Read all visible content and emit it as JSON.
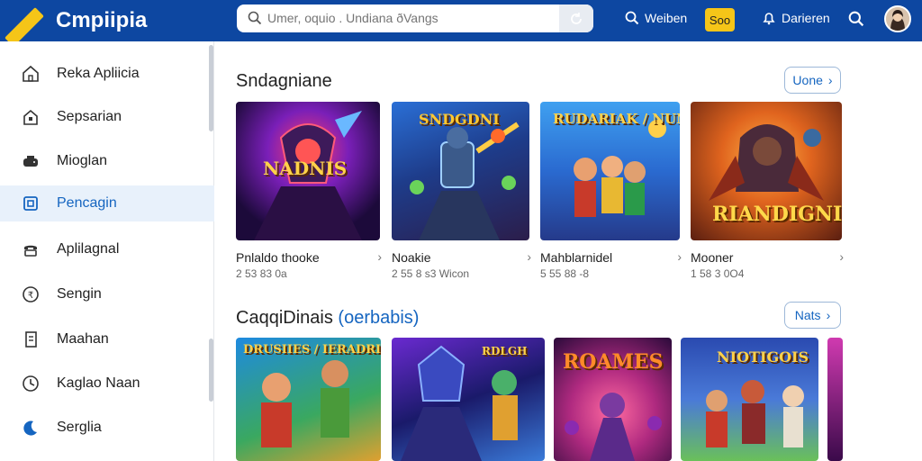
{
  "app": {
    "name": "Cmpiipia"
  },
  "search": {
    "placeholder": "Umer, oquio . Undiana ðVangs"
  },
  "topbar": {
    "item1": "Weiben",
    "badge": "Soo",
    "item2": "Darieren"
  },
  "sidebar": {
    "items": [
      {
        "label": "Reka Apliicia",
        "icon": "home-icon"
      },
      {
        "label": "Sepsarian",
        "icon": "house-lock-icon"
      },
      {
        "label": "Mioglan",
        "icon": "controller-icon"
      },
      {
        "label": "Pencagin",
        "icon": "square-icon",
        "active": true
      },
      {
        "label": "Aplilagnal",
        "icon": "phone-icon"
      },
      {
        "label": "Sengin",
        "icon": "coin-icon"
      },
      {
        "label": "Maahan",
        "icon": "document-icon"
      },
      {
        "label": "Kaglao Naan",
        "icon": "clock-icon"
      },
      {
        "label": "Serglia",
        "icon": "moon-icon"
      }
    ]
  },
  "section1": {
    "title": "Sndagniane",
    "more_label": "Uone",
    "cards": [
      {
        "title": "Pnlaldo thooke",
        "meta": "2 53 83 0a",
        "art": "NADNIS"
      },
      {
        "title": "Noakie",
        "meta": "2 55 8 s3 Wicon",
        "art": "SNDGDNI"
      },
      {
        "title": "Mahblarnidel",
        "meta": "5 55 88 -8",
        "art": "RUDARIAK / NUNME"
      },
      {
        "title": "Mooner",
        "meta": "1 58 3 0O4",
        "art": "RIANDIGNI"
      }
    ]
  },
  "section2": {
    "title": "CaqqiDinais",
    "title_accent": "(oerbabis)",
    "more_label": "Nats",
    "tiles": [
      {
        "art": "DRUSIIES / IERADRINE"
      },
      {
        "art": "RDLGH"
      },
      {
        "art": "ROAMES"
      },
      {
        "art": "NIOTIGOIS"
      }
    ]
  },
  "colors": {
    "topbar": "#0d47a1",
    "accent": "#1565c0",
    "badge": "#f5c518",
    "active_bg": "#e8f1fb"
  }
}
